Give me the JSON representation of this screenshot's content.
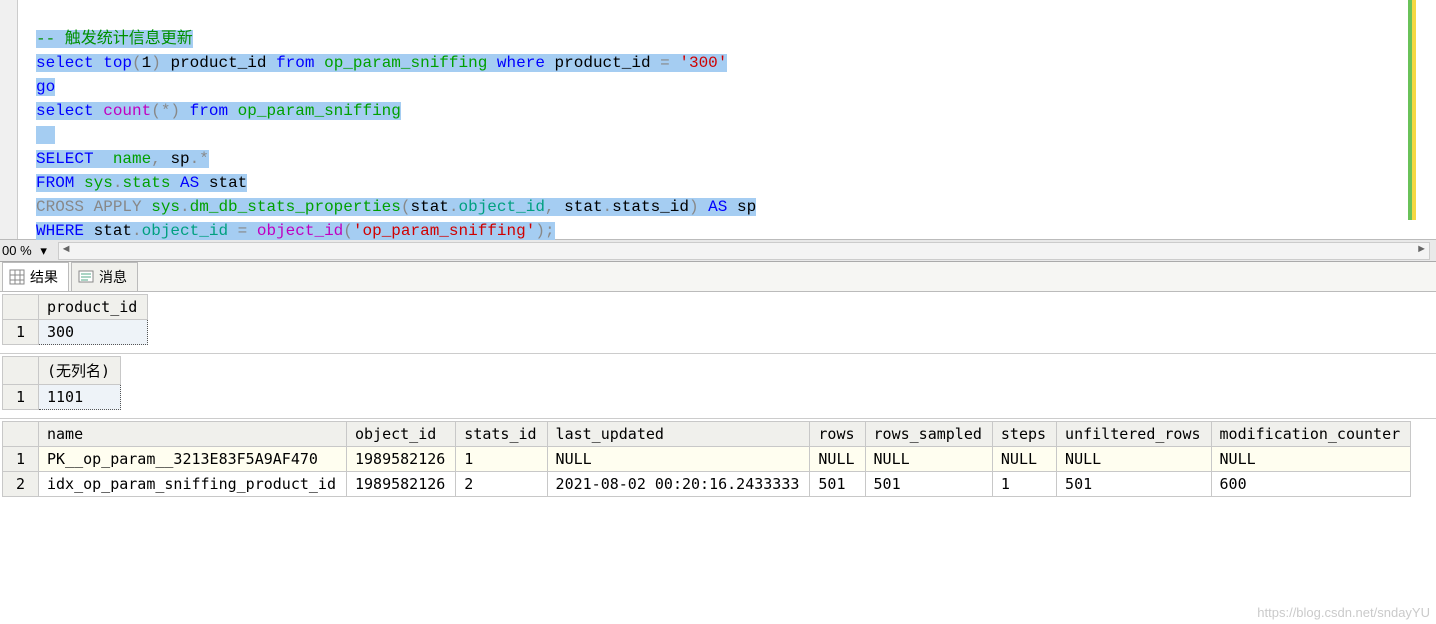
{
  "code": {
    "comment": "-- 触发统计信息更新",
    "l2": {
      "select": "select",
      "top": "top",
      "p1": "(",
      "one": "1",
      "p2": ")",
      "col": " product_id ",
      "from": "from",
      "tbl": " op_param_sniffing ",
      "where": "where",
      "cond": " product_id ",
      "eq": "=",
      "lit": " '300'"
    },
    "l3": "go",
    "l4": {
      "select": "select",
      "count": " count",
      "p1": "(*)",
      "from": " from",
      "tbl": " op_param_sniffing"
    },
    "l6": {
      "select": "SELECT ",
      "name": " name",
      "c": ",",
      "sp": " sp",
      "dot": ".",
      "star": "*"
    },
    "l7": {
      "from": "FROM ",
      "sys": "sys",
      "dot": ".",
      "stats": "stats",
      "as": " AS",
      "alias": " stat"
    },
    "l8": {
      "cross": "CROSS APPLY ",
      "sys": "sys",
      "dot": ".",
      "fn": "dm_db_stats_properties",
      "p1": "(",
      "stat1": "stat",
      "d1": ".",
      "oid": "object_id",
      "c": ",",
      "stat2": " stat",
      "d2": ".",
      "sid": "stats_id",
      "p2": ")",
      "as": " AS",
      "sp": " sp"
    },
    "l9": {
      "where": "WHERE ",
      "stat": "stat",
      "dot": ".",
      "oid": "object_id",
      "eq": " = ",
      "fn": "object_id",
      "p1": "(",
      "lit": "'op_param_sniffing'",
      "p2": ")",
      "sc": ";"
    }
  },
  "zoom": "00 %",
  "tabs": {
    "results": "结果",
    "messages": "消息"
  },
  "grid1": {
    "header": "product_id",
    "row1": "300"
  },
  "grid2": {
    "header": "(无列名)",
    "row1": "1101"
  },
  "grid3": {
    "headers": [
      "name",
      "object_id",
      "stats_id",
      "last_updated",
      "rows",
      "rows_sampled",
      "steps",
      "unfiltered_rows",
      "modification_counter"
    ],
    "rows": [
      [
        "PK__op_param__3213E83F5A9AF470",
        "1989582126",
        "1",
        "NULL",
        "NULL",
        "NULL",
        "NULL",
        "NULL",
        "NULL"
      ],
      [
        "idx_op_param_sniffing_product_id",
        "1989582126",
        "2",
        "2021-08-02 00:20:16.2433333",
        "501",
        "501",
        "1",
        "501",
        "600"
      ]
    ]
  },
  "watermark": "https://blog.csdn.net/sndayYU"
}
